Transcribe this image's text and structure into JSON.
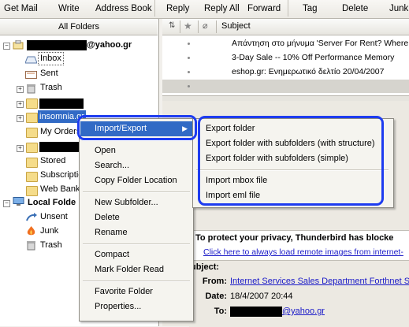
{
  "toolbar": {
    "buttons": [
      "Get Mail",
      "Write",
      "Address Book",
      "Reply",
      "Reply All",
      "Forward",
      "Tag",
      "Delete",
      "Junk"
    ]
  },
  "folder_pane": {
    "header": "All Folders",
    "account_suffix": "@yahoo.gr",
    "items": {
      "inbox": "Inbox",
      "sent": "Sent",
      "trash": "Trash",
      "insomnia": "insomnia.gr",
      "my_orders": "My Orders",
      "stored": "Stored",
      "subscriptions": "Subscriptio",
      "web_bank": "Web Bank",
      "local_folders": "Local Folde",
      "unsent": "Unsent",
      "junk": "Junk",
      "local_trash": "Trash"
    }
  },
  "message_list": {
    "subject_header": "Subject",
    "rows": [
      {
        "subject": "Απάντηση στο μήνυμα 'Server For Rent? Where"
      },
      {
        "subject": "3-Day Sale -- 10% Off Performance Memory"
      },
      {
        "subject": "eshop.gr: Ενημερωτικό δελτίο 20/04/2007"
      },
      {
        "subject": ""
      }
    ]
  },
  "preview": {
    "privacy_text": "To protect your privacy, Thunderbird has blocke",
    "remote_images_link": "Click here to always load remote images from internet-",
    "subject_label": "ubject:",
    "from_label": "From:",
    "from_value": "Internet Services Sales Department Forthnet S",
    "date_label": "Date:",
    "date_value": "18/4/2007 20:44",
    "to_label": "To:",
    "to_suffix": "@yahoo.gr"
  },
  "context_menu": {
    "import_export": "Import/Export",
    "open": "Open",
    "search": "Search...",
    "copy_location": "Copy Folder Location",
    "new_subfolder": "New Subfolder...",
    "delete": "Delete",
    "rename": "Rename",
    "compact": "Compact",
    "mark_read": "Mark Folder Read",
    "favorite": "Favorite Folder",
    "properties": "Properties..."
  },
  "submenu": {
    "export_folder": "Export folder",
    "export_with_subfolders_structure": "Export folder with subfolders (with structure)",
    "export_with_subfolders_simple": "Export folder with subfolders (simple)",
    "import_mbox": "Import mbox file",
    "import_eml": "Import eml file"
  },
  "colors": {
    "annotation": "#1e3cf0",
    "highlight": "#316ac5",
    "link": "#1a1ac8"
  }
}
